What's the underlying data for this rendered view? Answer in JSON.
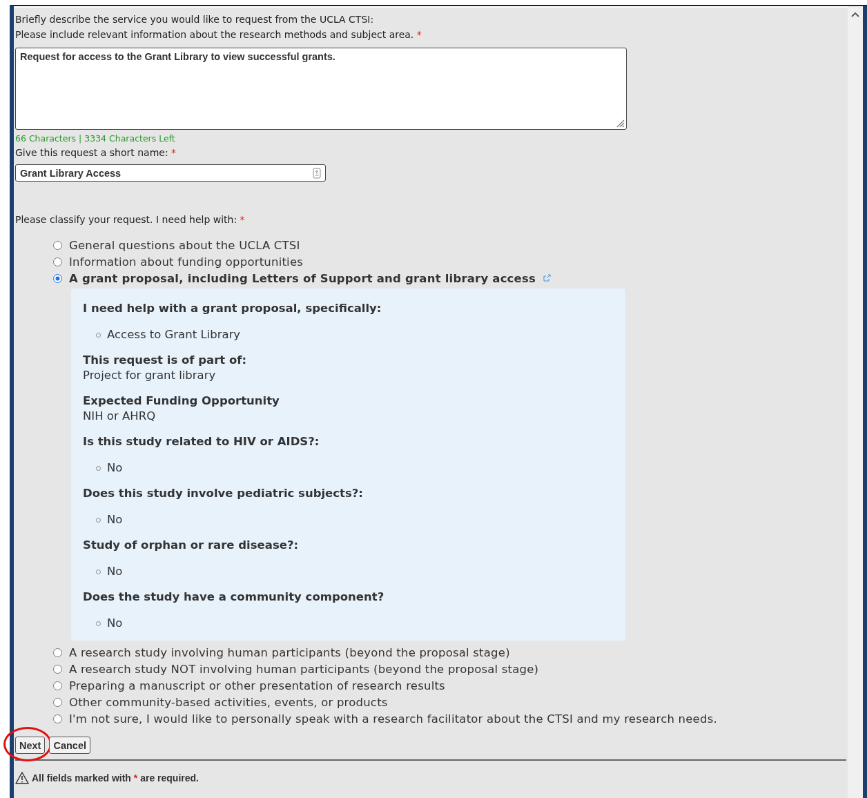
{
  "prompt": {
    "lines": [
      "Briefly describe the service you would like to request from the UCLA CTSI:",
      "Please include relevant information about the research methods and subject area."
    ],
    "required_mark": "*"
  },
  "description": {
    "value": "Request for access to the Grant Library to view successful grants."
  },
  "char_count": "66 Characters | 3334 Characters Left",
  "short_name": {
    "label": "Give this request a short name:",
    "required_mark": "*",
    "value": "Grant Library Access"
  },
  "classify": {
    "label": "Please classify your request. I need help with:",
    "required_mark": "*",
    "options": [
      {
        "label": "General questions about the UCLA CTSI",
        "selected": false
      },
      {
        "label": "Information about funding opportunities",
        "selected": false
      },
      {
        "label": "A grant proposal, including Letters of Support and grant library access",
        "selected": true,
        "external_link": true,
        "details": [
          {
            "kind": "bulleted",
            "title": "I need help with a grant proposal, specifically:",
            "values": [
              "Access to Grant Library"
            ]
          },
          {
            "kind": "plain",
            "title": "This request is of part of:",
            "value": "Project for grant library"
          },
          {
            "kind": "plain",
            "title": "Expected Funding Opportunity",
            "value": "NIH or AHRQ"
          },
          {
            "kind": "bulleted",
            "title": "Is this study related to HIV or AIDS?:",
            "values": [
              "No"
            ]
          },
          {
            "kind": "bulleted",
            "title": "Does this study involve pediatric subjects?:",
            "values": [
              "No"
            ]
          },
          {
            "kind": "bulleted",
            "title": "Study of orphan or rare disease?:",
            "values": [
              "No"
            ]
          },
          {
            "kind": "bulleted",
            "title": "Does the study have a community component?",
            "values": [
              "No"
            ]
          }
        ]
      },
      {
        "label": "A research study involving human participants (beyond the proposal stage)",
        "selected": false
      },
      {
        "label": "A research study NOT involving human participants (beyond the proposal stage)",
        "selected": false
      },
      {
        "label": "Preparing a manuscript or other presentation of research results",
        "selected": false
      },
      {
        "label": "Other community-based activities, events, or products",
        "selected": false
      },
      {
        "label": "I'm not sure, I would like to personally speak with a research facilitator about the CTSI and my research needs.",
        "selected": false
      }
    ]
  },
  "buttons": [
    {
      "label": "Next",
      "circled": true
    },
    {
      "label": "Cancel",
      "circled": false
    }
  ],
  "footer": {
    "before": "All fields marked with",
    "mark": "*",
    "after": "are required."
  }
}
